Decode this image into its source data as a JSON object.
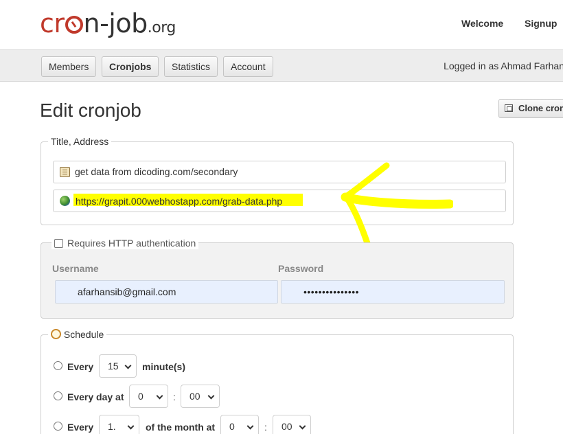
{
  "header": {
    "logo": {
      "part1": "cr",
      "part2": "n-job",
      "suffix": ".org"
    },
    "links": {
      "welcome": "Welcome",
      "signup": "Signup"
    }
  },
  "nav": {
    "tabs": [
      {
        "label": "Members"
      },
      {
        "label": "Cronjobs",
        "active": true
      },
      {
        "label": "Statistics"
      },
      {
        "label": "Account"
      }
    ],
    "logged_in": "Logged in as Ahmad Farhan"
  },
  "page": {
    "title": "Edit cronjob",
    "clone_label": "Clone cronjob"
  },
  "title_address": {
    "legend": "Title, Address",
    "title_value": "get data from dicoding.com/secondary",
    "url_value": "https://grapit.000webhostapp.com/grab-data.php",
    "title_icon": "note-icon",
    "url_icon": "globe-icon"
  },
  "auth": {
    "legend": "Requires HTTP authentication",
    "checked": false,
    "username_label": "Username",
    "password_label": "Password",
    "username_value": "afarhansib@gmail.com",
    "password_value": "•••••••••••••••"
  },
  "schedule": {
    "legend": "Schedule",
    "row1": {
      "prefix": "Every",
      "value": "15",
      "suffix": "minute(s)"
    },
    "row2": {
      "prefix": "Every day at",
      "hour": "0",
      "minute": "00"
    },
    "row3": {
      "prefix": "Every",
      "day": "1.",
      "middle": "of the month at",
      "hour": "0",
      "minute": "00"
    },
    "separator": ":"
  },
  "annotation": {
    "highlight_color": "#ffff00",
    "arrow_color": "#ffff00"
  }
}
